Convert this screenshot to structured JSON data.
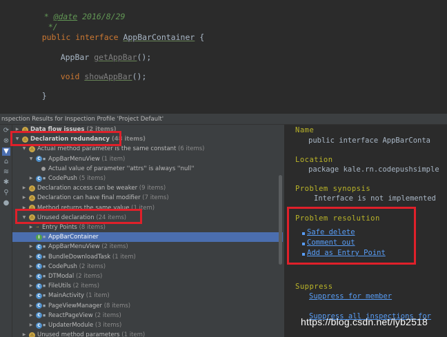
{
  "editor": {
    "doc_prefix": "* ",
    "doc_tag": "@date",
    "doc_date": " 2016/8/29",
    "doc_close": "*/",
    "kw_public": "public",
    "kw_interface": "interface",
    "iface_name": "AppBarContainer",
    "open_brace": "{",
    "m1_type": "AppBar",
    "m1_name": "getAppBar",
    "m1_tail": "();",
    "m2_type": "void",
    "m2_name": "showAppBar",
    "m2_tail": "();",
    "close_brace": "}"
  },
  "tool_window": {
    "title": "nspection Results for Inspection Profile 'Project Default'"
  },
  "tree": [
    {
      "label": "Data flow issues",
      "count": "(2 items)",
      "level": 0,
      "arrow": "▶",
      "icon": "sev",
      "bold": true
    },
    {
      "label": "Declaration redundancy",
      "count": "(48 items)",
      "level": 0,
      "arrow": "▼",
      "icon": "sev",
      "bold": true
    },
    {
      "label": "Actual method parameter is the same constant",
      "count": "(6 items)",
      "level": 1,
      "arrow": "▼",
      "icon": "sev"
    },
    {
      "label": "AppBarMenuView",
      "count": "(1 item)",
      "level": 2,
      "arrow": "▼",
      "icon": "cls"
    },
    {
      "label": "Actual value of parameter ''attrs'' is always ''null''",
      "count": "",
      "level": 3,
      "arrow": "",
      "icon": "bullet"
    },
    {
      "label": "CodePush",
      "count": "(5 items)",
      "level": 2,
      "arrow": "▶",
      "icon": "cls"
    },
    {
      "label": "Declaration access can be weaker",
      "count": "(9 items)",
      "level": 1,
      "arrow": "▶",
      "icon": "sev"
    },
    {
      "label": "Declaration can have final modifier",
      "count": "(7 items)",
      "level": 1,
      "arrow": "▶",
      "icon": "sev"
    },
    {
      "label": "Method returns the same value",
      "count": "(1 item)",
      "level": 1,
      "arrow": "▶",
      "icon": "sev"
    },
    {
      "label": "Unused declaration",
      "count": "(24 items)",
      "level": 1,
      "arrow": "▼",
      "icon": "sev"
    },
    {
      "label": "Entry Points",
      "count": "(8 items)",
      "level": 2,
      "arrow": "▶",
      "icon": "entry"
    },
    {
      "label": "AppBarContainer",
      "count": "",
      "level": 2,
      "arrow": "",
      "icon": "cls-green",
      "selected": true
    },
    {
      "label": "AppBarMenuView",
      "count": "(2 items)",
      "level": 2,
      "arrow": "▶",
      "icon": "cls"
    },
    {
      "label": "BundleDownloadTask",
      "count": "(1 item)",
      "level": 2,
      "arrow": "▶",
      "icon": "cls"
    },
    {
      "label": "CodePush",
      "count": "(2 items)",
      "level": 2,
      "arrow": "▶",
      "icon": "cls"
    },
    {
      "label": "DTModal",
      "count": "(2 items)",
      "level": 2,
      "arrow": "▶",
      "icon": "cls"
    },
    {
      "label": "FileUtils",
      "count": "(2 items)",
      "level": 2,
      "arrow": "▶",
      "icon": "cls"
    },
    {
      "label": "MainActivity",
      "count": "(1 item)",
      "level": 2,
      "arrow": "▶",
      "icon": "cls"
    },
    {
      "label": "PageViewManager",
      "count": "(8 items)",
      "level": 2,
      "arrow": "▶",
      "icon": "cls"
    },
    {
      "label": "ReactPageView",
      "count": "(2 items)",
      "level": 2,
      "arrow": "▶",
      "icon": "cls"
    },
    {
      "label": "UpdaterModule",
      "count": "(3 items)",
      "level": 2,
      "arrow": "▶",
      "icon": "cls"
    },
    {
      "label": "Unused method parameters",
      "count": "(1 item)",
      "level": 1,
      "arrow": "▶",
      "icon": "sev"
    }
  ],
  "details": {
    "name_head": "Name",
    "name_value": "public interface AppBarConta",
    "location_head": "Location",
    "location_value": "package kale.rn.codepushsimple",
    "synopsis_head": "Problem synopsis",
    "synopsis_value": "Interface is not implemented",
    "resolution_head": "Problem resolution",
    "fixes": [
      "Safe delete",
      "Comment out",
      "Add as Entry Point"
    ],
    "suppress_head": "Suppress",
    "suppress_member": "Suppress for member",
    "suppress_all": "Suppress all inspections for"
  },
  "watermark": "https://blog.csdn.net/lyb2518",
  "colors": {
    "annotation_red": "#e0202a",
    "selection": "#4b6eaf",
    "link": "#589df6",
    "heading": "#bbb529"
  }
}
